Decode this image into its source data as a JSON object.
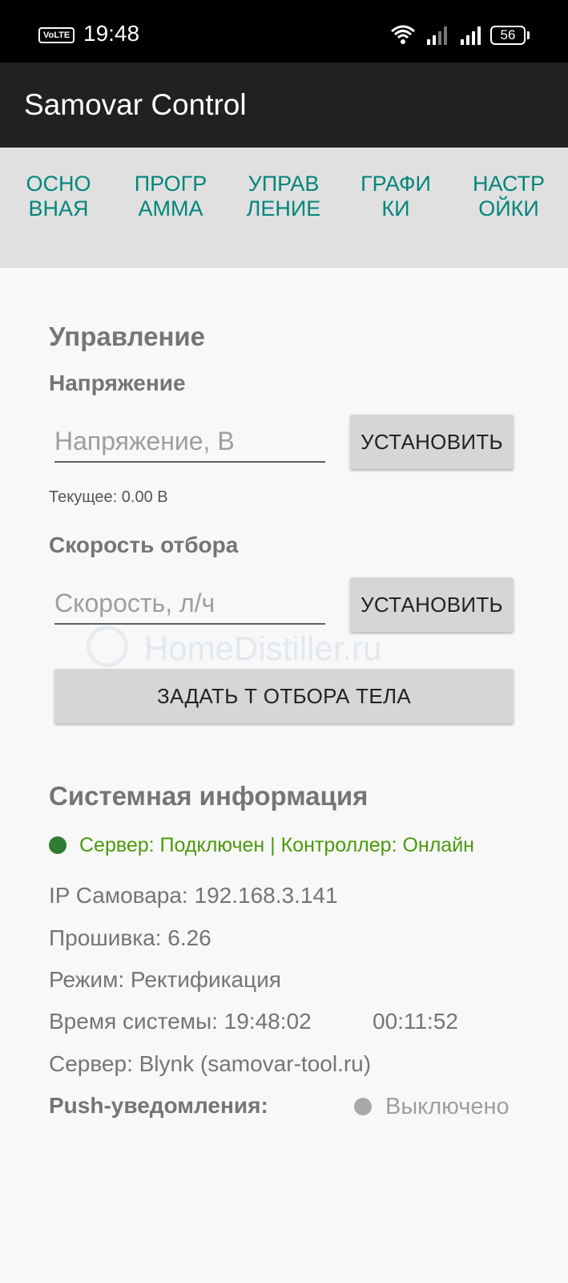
{
  "status_bar": {
    "volte": "VoLTE",
    "time": "19:48",
    "battery": "56"
  },
  "app": {
    "title": "Samovar Control"
  },
  "tabs": [
    {
      "label": "ОСНОВНАЯ"
    },
    {
      "label": "ПРОГРАММА"
    },
    {
      "label": "УПРАВЛЕНИЕ"
    },
    {
      "label": "ГРАФИКИ"
    },
    {
      "label": "НАСТРОЙКИ"
    }
  ],
  "watermark": {
    "text": "HomeDistiller.ru"
  },
  "control": {
    "heading": "Управление",
    "voltage": {
      "heading": "Напряжение",
      "placeholder": "Напряжение, В",
      "button": "УСТАНОВИТЬ",
      "current": "Текущее: 0.00 В"
    },
    "speed": {
      "heading": "Скорость отбора",
      "placeholder": "Скорость, л/ч",
      "button": "УСТАНОВИТЬ"
    },
    "body_temp_button": "ЗАДАТЬ Т ОТБОРА ТЕЛА"
  },
  "system": {
    "heading": "Системная информация",
    "status": "Сервер: Подключен | Контроллер: Онлайн",
    "status_color": "#2e7d32",
    "ip": "IP Самовара: 192.168.3.141",
    "firmware": "Прошивка: 6.26",
    "mode": "Режим: Ректификация",
    "time_label": "Время системы: 19:48:02",
    "uptime": "00:11:52",
    "server": "Сервер: Blynk (samovar-tool.ru)",
    "push_label": "Push-уведомления:",
    "push_status": "Выключено",
    "push_color": "#a8a8a8"
  }
}
